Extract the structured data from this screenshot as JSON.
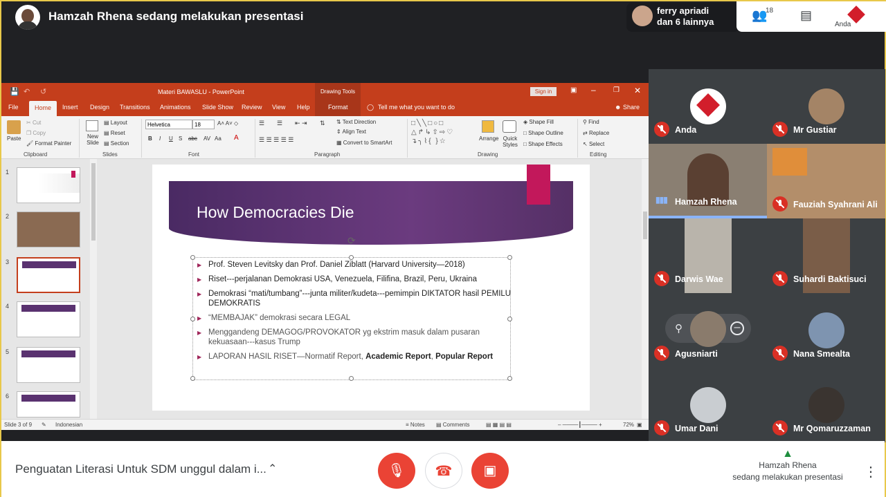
{
  "top": {
    "presenting_title": "Hamzah Rhena sedang melakukan presentasi",
    "pill_name_line1": "ferry apriadi",
    "pill_name_line2": "dan 6 lainnya",
    "people_count": "18",
    "you_label": "Anda"
  },
  "ppt": {
    "window_title": "Materi BAWASLU  -  PowerPoint",
    "contextual_tab": "Drawing Tools",
    "signin": "Sign in",
    "tabs": [
      "File",
      "Home",
      "Insert",
      "Design",
      "Transitions",
      "Animations",
      "Slide Show",
      "Review",
      "View",
      "Help",
      "Format"
    ],
    "tell_me": "Tell me what you want to do",
    "share": "Share",
    "ribbon": {
      "paste": "Paste",
      "cut": "Cut",
      "copy": "Copy",
      "format_painter": "Format Painter",
      "clipboard": "Clipboard",
      "new_slide": "New Slide",
      "layout": "Layout",
      "reset": "Reset",
      "section": "Section",
      "slides": "Slides",
      "font_name": "Helvetica",
      "font_size": "18",
      "font": "Font",
      "text_direction": "Text Direction",
      "align_text": "Align Text",
      "convert_smartart": "Convert to SmartArt",
      "paragraph": "Paragraph",
      "arrange": "Arrange",
      "quick_styles": "Quick Styles",
      "shape_fill": "Shape Fill",
      "shape_outline": "Shape Outline",
      "shape_effects": "Shape Effects",
      "drawing": "Drawing",
      "find": "Find",
      "replace": "Replace",
      "select": "Select",
      "editing": "Editing"
    },
    "thumb_numbers": [
      "1",
      "2",
      "3",
      "4",
      "5",
      "6"
    ],
    "slide": {
      "title": "How Democracies Die",
      "bullets": [
        "Prof. Steven Levitsky dan Prof. Daniel Ziblatt (Harvard University—2018)",
        "Riset---perjalanan Demokrasi USA, Venezuela, Filifina, Brazil, Peru, Ukraina",
        "Demokrasi “mati/tumbang”---junta militer/kudeta---pemimpin DIKTATOR hasil PEMILU DEMOKRATIS",
        "“MEMBAJAK” demokrasi secara LEGAL",
        "Menggandeng DEMAGOG/PROVOKATOR yg ekstrim masuk dalam pusaran kekuasaan---kasus Trump",
        "LAPORAN HASIL RISET—Normatif Report, "
      ],
      "bullet6_bold": "Academic Report",
      "bullet6_sep": ", ",
      "bullet6_bold2": "Popular Report"
    },
    "status": {
      "slide_of": "Slide 3 of 9",
      "language": "Indonesian",
      "notes": "Notes",
      "comments": "Comments",
      "zoom": "72%"
    }
  },
  "participants": [
    {
      "name": "Anda"
    },
    {
      "name": "Mr Gustiar"
    },
    {
      "name": "Hamzah Rhena"
    },
    {
      "name": "Fauziah Syahrani Ali"
    },
    {
      "name": "Darwis Wae"
    },
    {
      "name": "Suhardi Baktisuci"
    },
    {
      "name": "Agusniarti"
    },
    {
      "name": "Nana Smealta"
    },
    {
      "name": "Umar Dani"
    },
    {
      "name": "Mr Qomaruzzaman"
    }
  ],
  "bottom": {
    "meeting_title": "Penguatan Literasi Untuk SDM unggul dalam i...",
    "presenting_line1": "Hamzah Rhena",
    "presenting_line2": "sedang melakukan presentasi"
  },
  "colors": {
    "accent_red": "#ea4335",
    "ppt_orange": "#c43e1c",
    "slide_purple": "#5a3270",
    "active_speaker": "#8ab4f8"
  }
}
